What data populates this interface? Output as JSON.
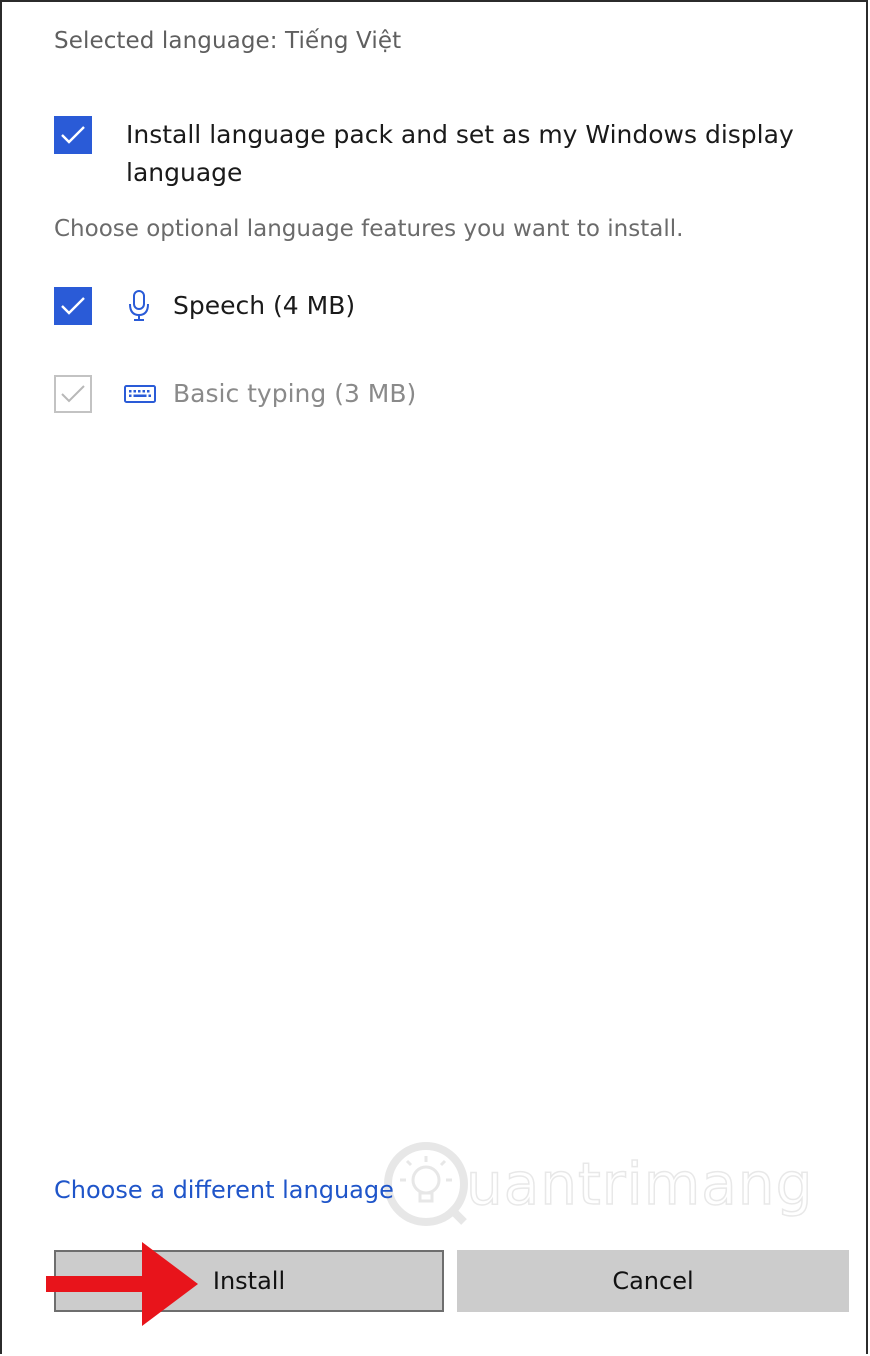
{
  "dialog": {
    "selected_language": "Selected language: Tiếng Việt",
    "display_language_option": {
      "checked": true,
      "label_line1": "Install language pack and set as my Windows display",
      "label_line2": "language"
    },
    "helper_text": "Choose optional language features you want to install.",
    "features": [
      {
        "icon": "microphone-icon",
        "label": "Speech (4 MB)",
        "checked": true,
        "enabled": true
      },
      {
        "icon": "keyboard-icon",
        "label": "Basic typing (3 MB)",
        "checked": true,
        "enabled": false
      }
    ],
    "link_text": "Choose a different language",
    "watermark_text": "uantrimang",
    "buttons": {
      "install_label": "Install",
      "cancel_label": "Cancel"
    }
  },
  "colors": {
    "accent": "#2a5bd7",
    "link": "#1f55c9",
    "button_bg": "#cccccc",
    "arrow": "#e8141b"
  }
}
